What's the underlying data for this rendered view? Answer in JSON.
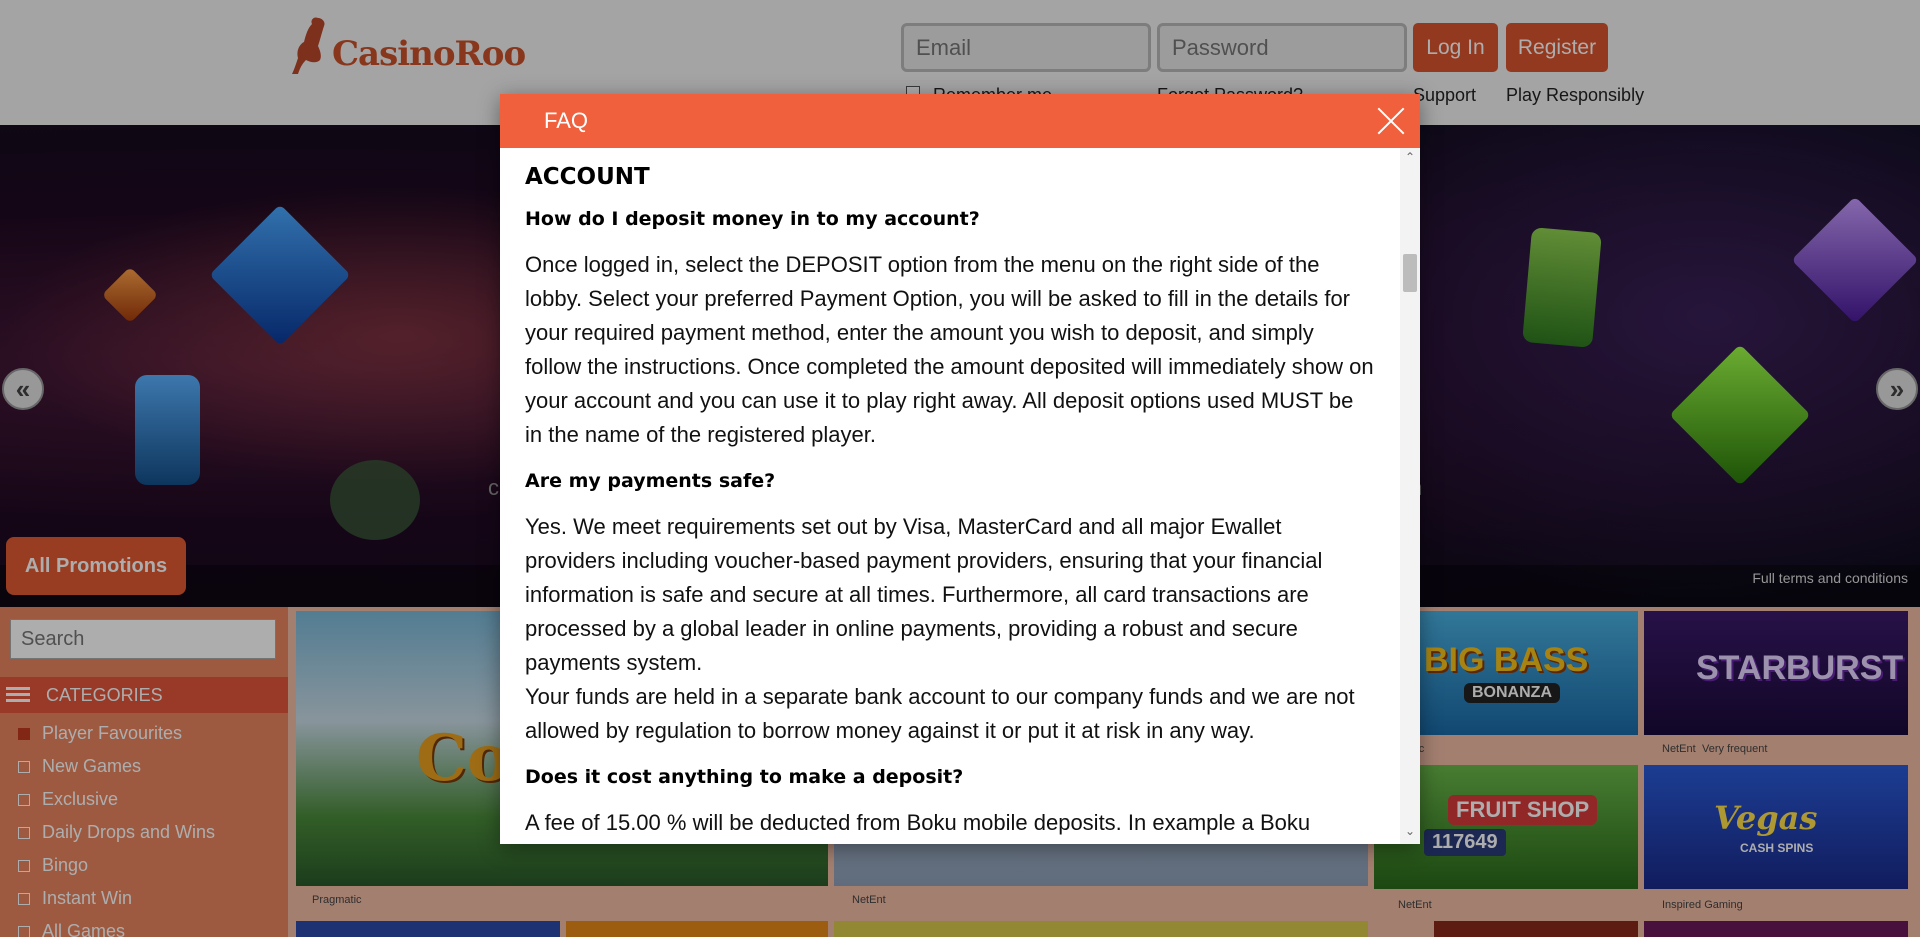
{
  "header": {
    "logo_text": "CasinoRoo",
    "email_placeholder": "Email",
    "password_placeholder": "Password",
    "login_label": "Log In",
    "register_label": "Register",
    "remember_label": "Remember me",
    "forgot_label": "Forgot Password?",
    "support_label": "Support",
    "responsibly_label": "Play Responsibly"
  },
  "hero": {
    "promotions_label": "All Promotions",
    "terms_label": "Full terms and conditions",
    "ghost_left": "c",
    "ghost_right": "n",
    "prev_icon": "«",
    "next_icon": "»"
  },
  "sidebar": {
    "search_placeholder": "Search",
    "categories_label": "CATEGORIES",
    "items": [
      {
        "label": "Player Favourites",
        "checked": true
      },
      {
        "label": "New Games",
        "checked": false
      },
      {
        "label": "Exclusive",
        "checked": false
      },
      {
        "label": "Daily Drops and Wins",
        "checked": false
      },
      {
        "label": "Bingo",
        "checked": false
      },
      {
        "label": "Instant Win",
        "checked": false
      },
      {
        "label": "All Games",
        "checked": false
      }
    ]
  },
  "games": {
    "labels": {
      "tile1": "Pragmatic",
      "tile2": "NetEnt",
      "tile3": "matic",
      "tile4": "NetEnt",
      "tile4b": "Very frequent",
      "tile5": "NetEnt",
      "tile6": "Inspired Gaming"
    },
    "big_bass": "BIG BASS",
    "bonanza": "BONANZA",
    "starburst": "STARBURST",
    "fruit_shop": "FRUIT SHOP",
    "megaways": "117649",
    "vegas": "Vegas",
    "cash_spins": "CASH SPINS",
    "partial_title": "Co"
  },
  "modal": {
    "title": "FAQ",
    "section": "ACCOUNT",
    "q1": "How do I deposit money in to my account?",
    "a1": "Once logged in, select the DEPOSIT option from the menu on the right side of the lobby. Select your preferred Payment Option, you will be asked to fill in the details for your required payment method, enter the amount you wish to deposit, and simply follow the instructions. Once completed the amount deposited will immediately show on your account and you can use it to play right away. All deposit options used MUST be in the name of the registered player.",
    "q2": "Are my payments safe?",
    "a2a": "Yes.  We meet requirements set out by Visa, MasterCard and all major Ewallet providers including voucher-based payment providers, ensuring that your financial information is safe and secure at all times. Furthermore, all card transactions are processed by a global leader in online payments, providing a robust and secure payments system.",
    "a2b": "Your funds are held in a separate bank account to our company funds and we are not allowed by regulation to borrow money against it or put it at risk in any way.",
    "q3": "Does it cost anything to make a deposit?",
    "a3": "A fee of 15.00 % will be deducted from Boku mobile deposits. In example a Boku"
  }
}
